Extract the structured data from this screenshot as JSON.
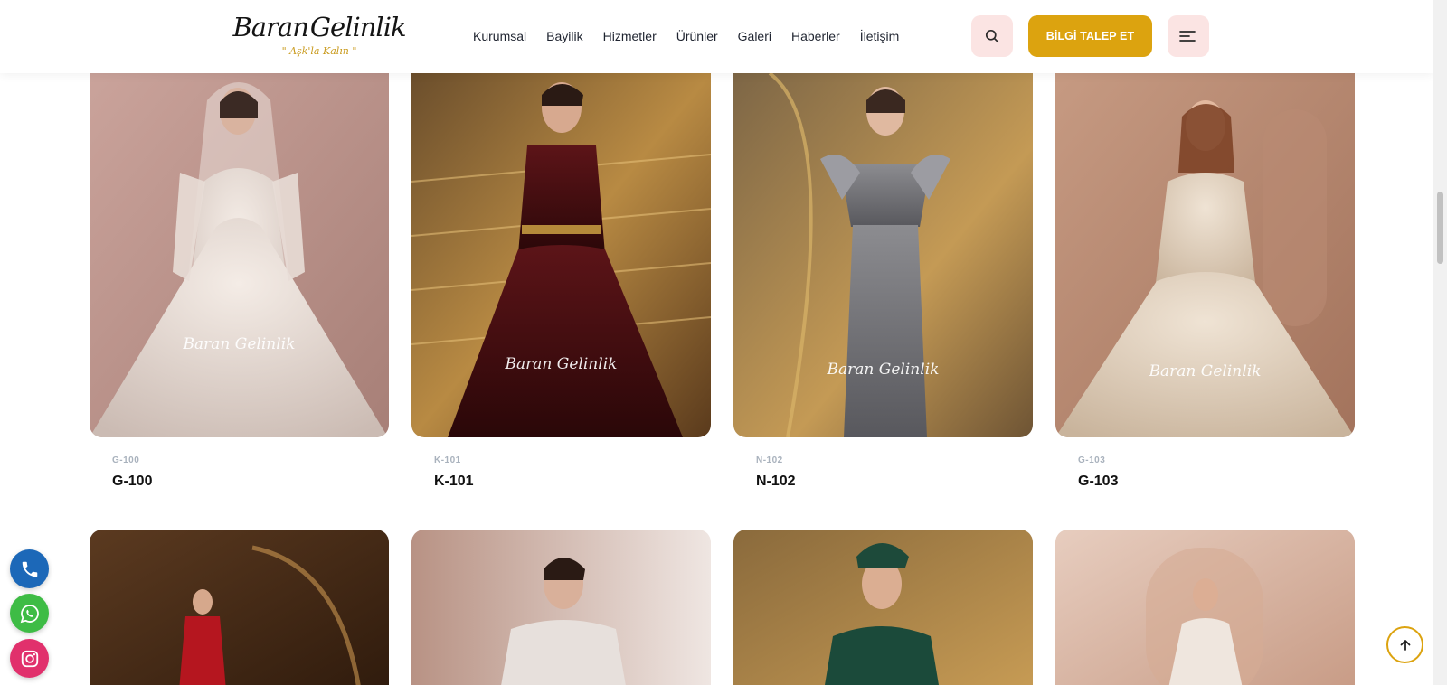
{
  "brand": {
    "name_left": "Baran",
    "name_right": "Gelinlik",
    "tagline": "\" Aşk'la Kalın \"",
    "accent_color": "#dca30f"
  },
  "nav": {
    "items": [
      "Kurumsal",
      "Bayilik",
      "Hizmetler",
      "Ürünler",
      "Galeri",
      "Haberler",
      "İletişim"
    ]
  },
  "header": {
    "search_icon": "search-icon",
    "cta_label": "BİLGİ TALEP ET",
    "menu_icon": "hamburger-menu-icon"
  },
  "products": {
    "row1": [
      {
        "code_small": "G-100",
        "code": "G-100",
        "watermark": "Baran Gelinlik"
      },
      {
        "code_small": "K-101",
        "code": "K-101",
        "watermark": "Baran Gelinlik"
      },
      {
        "code_small": "N-102",
        "code": "N-102",
        "watermark": "Baran Gelinlik"
      },
      {
        "code_small": "G-103",
        "code": "G-103",
        "watermark": "Baran Gelinlik"
      }
    ]
  },
  "floating": {
    "phone_icon": "phone-icon",
    "whatsapp_icon": "whatsapp-icon",
    "instagram_icon": "instagram-icon",
    "back_to_top_icon": "arrow-up-icon"
  }
}
